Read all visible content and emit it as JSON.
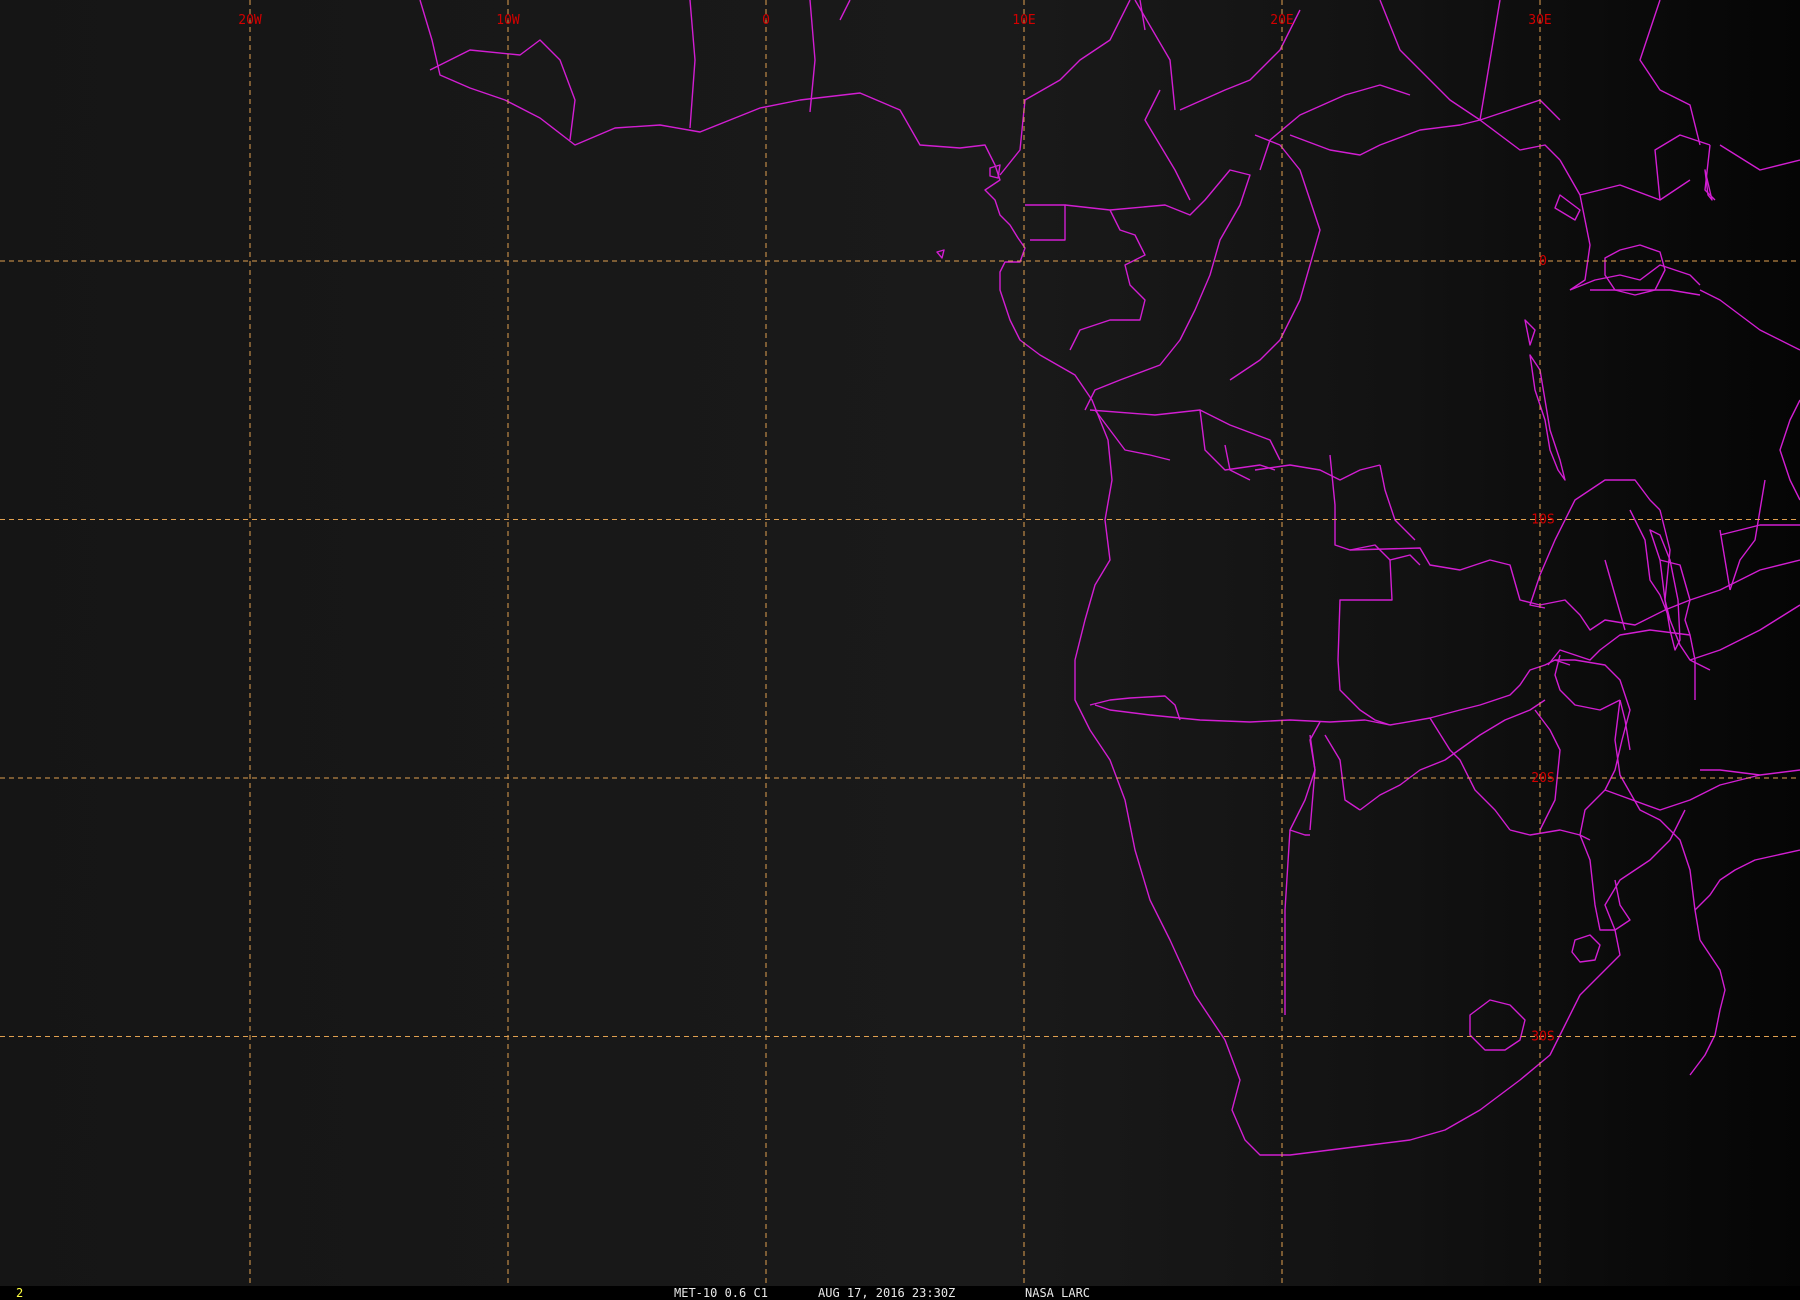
{
  "map": {
    "background_color": "#161616",
    "coastline_color": "#d21ed2",
    "graticule_color": "#e0a050",
    "label_color": "#d20000",
    "longitude_lines": [
      {
        "label": "20W",
        "lon": -20
      },
      {
        "label": "10W",
        "lon": -10
      },
      {
        "label": "0",
        "lon": 0
      },
      {
        "label": "10E",
        "lon": 10
      },
      {
        "label": "20E",
        "lon": 20
      },
      {
        "label": "30E",
        "lon": 30
      }
    ],
    "latitude_lines": [
      {
        "label": "0",
        "lat": 0
      },
      {
        "label": "10S",
        "lat": -10
      },
      {
        "label": "20S",
        "lat": -20
      },
      {
        "label": "30S",
        "lat": -30
      }
    ]
  },
  "footer": {
    "frame_number": "2",
    "satellite": "MET-10 0.6 C1",
    "datetime": "AUG 17, 2016 23:30Z",
    "agency": "NASA LARC"
  }
}
